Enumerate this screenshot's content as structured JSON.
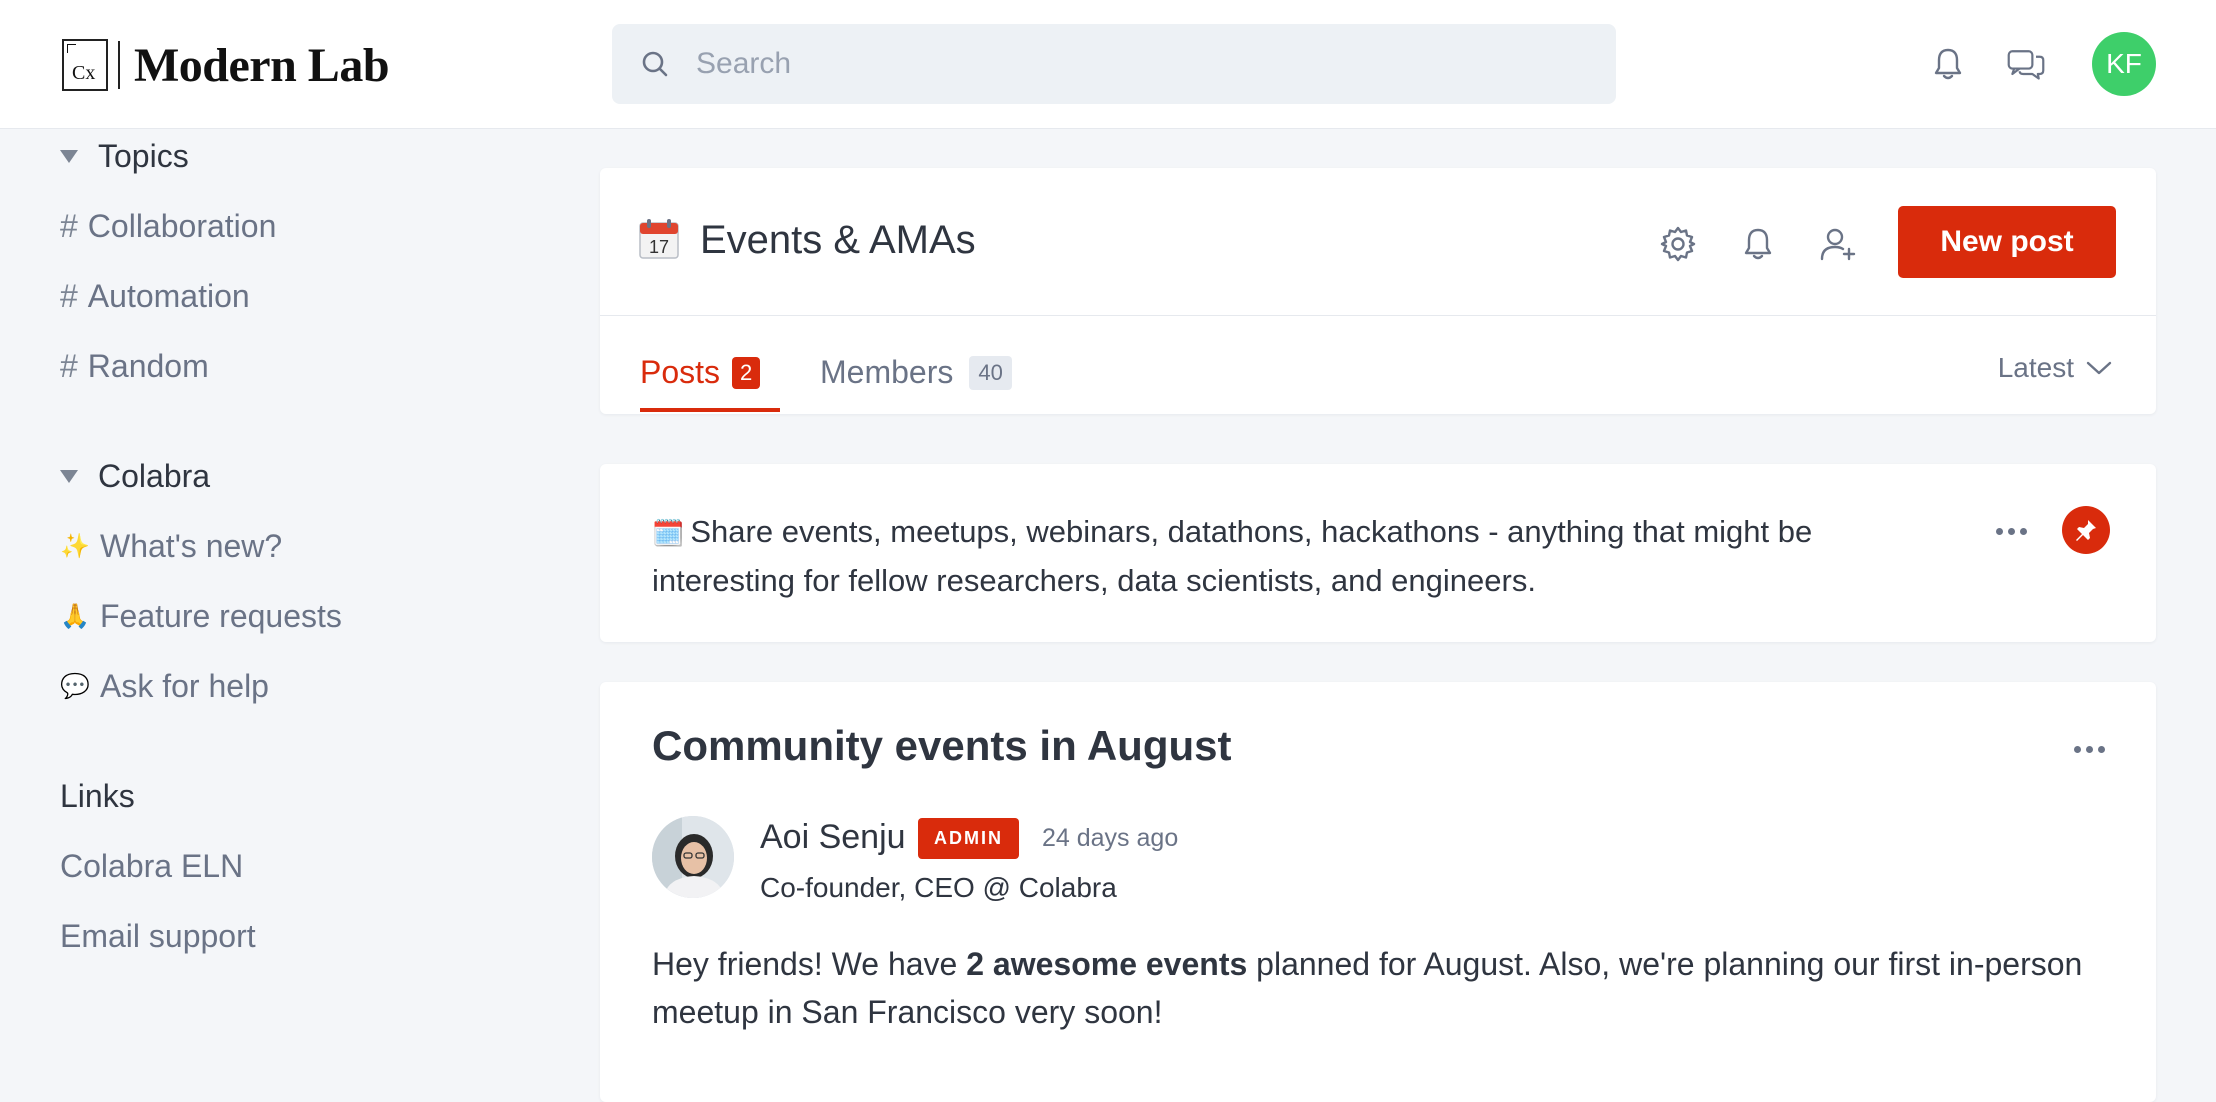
{
  "header": {
    "logo_mark": "Cx",
    "logo_text": "Modern Lab",
    "search_placeholder": "Search",
    "avatar_initials": "KF",
    "avatar_color": "#3ecf6a"
  },
  "sidebar": {
    "topics": {
      "heading": "Topics",
      "items": [
        {
          "prefix": "#",
          "label": "Collaboration"
        },
        {
          "prefix": "#",
          "label": "Automation"
        },
        {
          "prefix": "#",
          "label": "Random"
        }
      ]
    },
    "colabra": {
      "heading": "Colabra",
      "items": [
        {
          "emoji": "✨",
          "label": "What's new?"
        },
        {
          "emoji": "🙏",
          "label": "Feature requests"
        },
        {
          "emoji": "💬",
          "label": "Ask for help"
        }
      ]
    },
    "links": {
      "heading": "Links",
      "items": [
        {
          "label": "Colabra ELN"
        },
        {
          "label": "Email support"
        }
      ]
    }
  },
  "channel": {
    "emoji": "📅",
    "title": "Events & AMAs",
    "new_post_label": "New post",
    "tabs": [
      {
        "label": "Posts",
        "count": "2"
      },
      {
        "label": "Members",
        "count": "40"
      }
    ],
    "sort_label": "Latest"
  },
  "description": {
    "emoji": "🗓️",
    "text": "Share events, meetups, webinars, datathons, hackathons - anything that might be interesting for fellow researchers, data scientists, and engineers."
  },
  "post": {
    "title": "Community events in August",
    "author": "Aoi Senju",
    "badge": "ADMIN",
    "time": "24 days ago",
    "role": "Co-founder, CEO @ Colabra",
    "body_before": "Hey friends! We have ",
    "body_bold": "2 awesome events",
    "body_after": " planned for August. Also, we're planning our first in-person meetup in San Francisco very soon!"
  },
  "colors": {
    "accent": "#d92b0c",
    "background": "#f4f6f9"
  }
}
